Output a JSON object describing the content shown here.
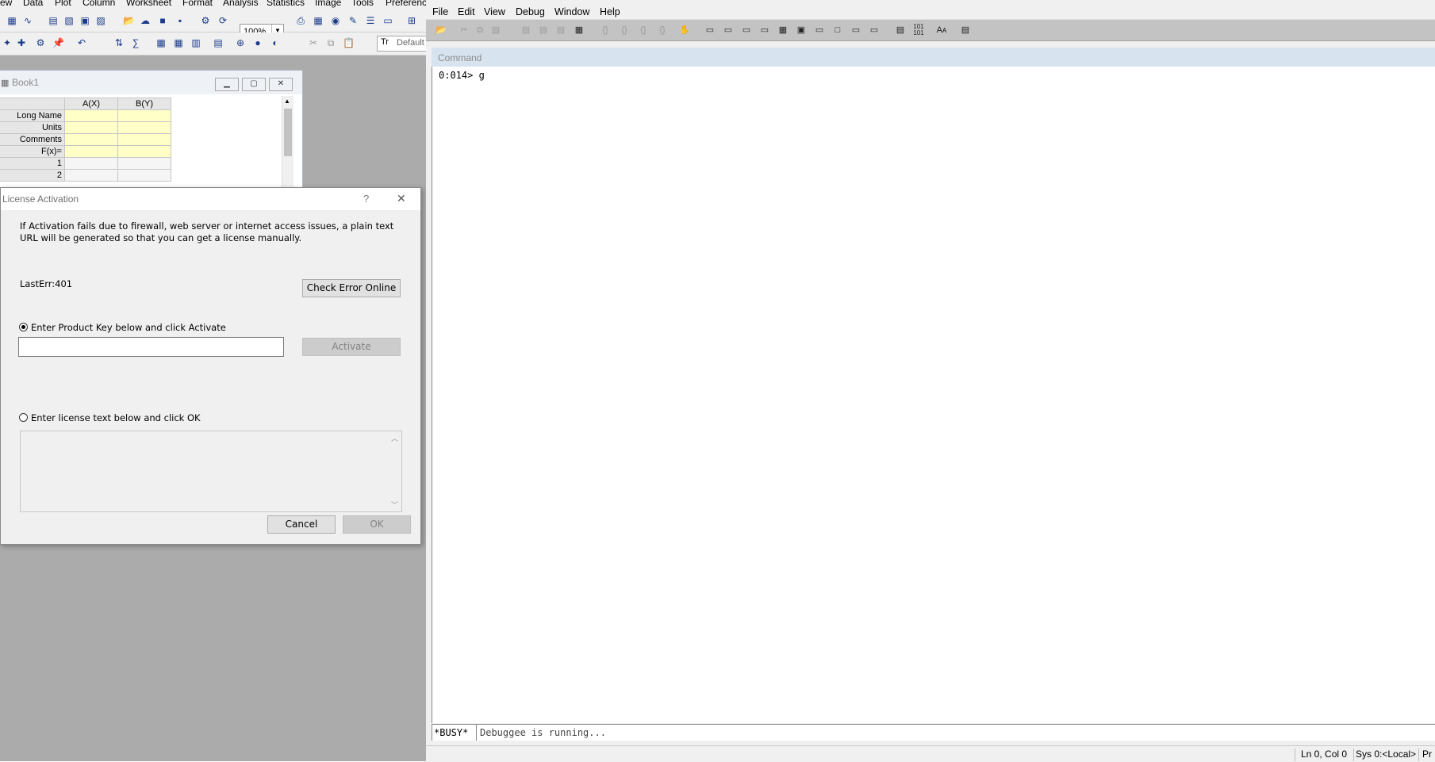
{
  "origin": {
    "menu": [
      "ew",
      "Data",
      "Plot",
      "Column",
      "Worksheet",
      "Format",
      "Analysis",
      "Statistics",
      "Image",
      "Tools",
      "Preferences"
    ],
    "zoom": "100%",
    "template_combo": "Default"
  },
  "book": {
    "title": "Book1",
    "columns": [
      "A(X)",
      "B(Y)"
    ],
    "row_headers": [
      "Long Name",
      "Units",
      "Comments",
      "F(x)=",
      "1",
      "2"
    ]
  },
  "dialog": {
    "title": "License Activation",
    "help_glyph": "?",
    "close_glyph": "✕",
    "description": "If Activation fails due to firewall, web server or internet access issues, a plain text URL will be generated so that you can get a license manually.",
    "last_error": "LastErr:401",
    "check_error_button": "Check Error Online",
    "option_product_key": "Enter Product Key below and click Activate",
    "product_key_value": "",
    "activate_button": "Activate",
    "option_license_text": "Enter license text below and click OK",
    "license_text_value": "",
    "cancel_button": "Cancel",
    "ok_button": "OK"
  },
  "debugger": {
    "menu": [
      "File",
      "Edit",
      "View",
      "Debug",
      "Window",
      "Help"
    ],
    "command_title": "Command",
    "command_output": "0:014> g",
    "busy_label": "*BUSY*",
    "input_text": "Debuggee is running...",
    "status": {
      "position": "Ln 0, Col 0",
      "system": "Sys 0:<Local>",
      "process": "Pr"
    }
  }
}
